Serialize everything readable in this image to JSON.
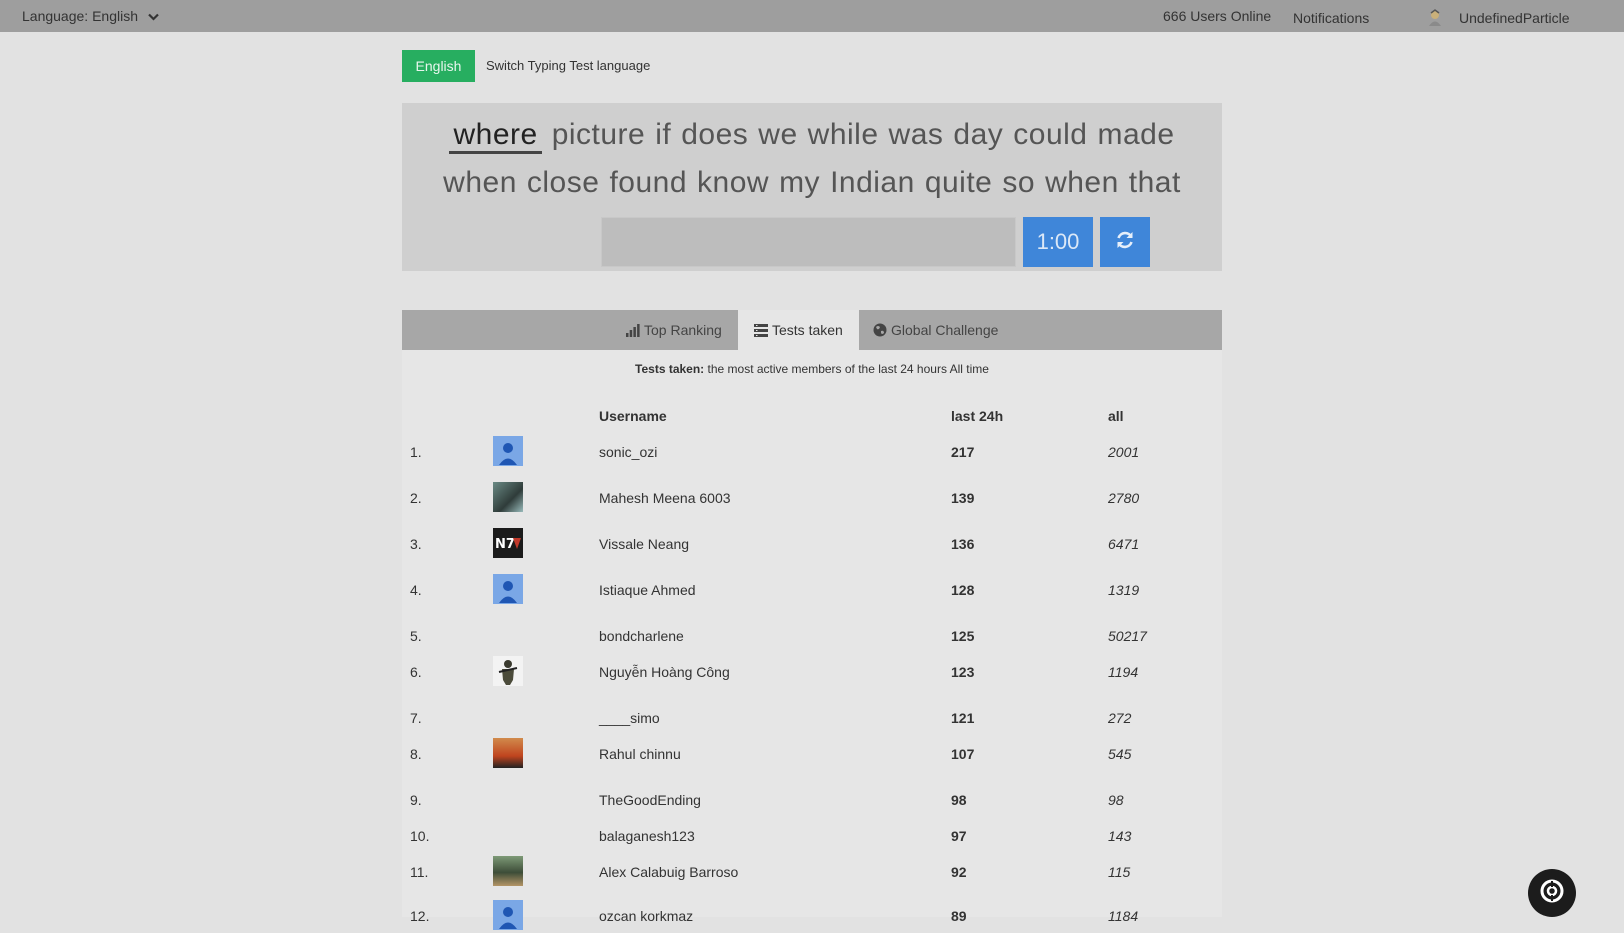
{
  "topbar": {
    "language_label": "Language: English",
    "users_online": "666 Users Online",
    "notifications": "Notifications",
    "username": "UndefinedParticle"
  },
  "language_switch": {
    "button": "English",
    "label": "Switch Typing Test language"
  },
  "typing": {
    "line1": [
      "where",
      "picture",
      "if",
      "does",
      "we",
      "while",
      "was",
      "day",
      "could",
      "made"
    ],
    "line2": [
      "when",
      "close",
      "found",
      "know",
      "my",
      "Indian",
      "quite",
      "so",
      "when",
      "that"
    ],
    "timer": "1:00"
  },
  "tabs": [
    {
      "label": "Top Ranking",
      "icon": "bar-chart-icon",
      "active": false
    },
    {
      "label": "Tests taken",
      "icon": "list-icon",
      "active": true
    },
    {
      "label": "Global Challenge",
      "icon": "globe-icon",
      "active": false
    }
  ],
  "description": {
    "bold": "Tests taken:",
    "text": " the most active members of the last 24 hours All time"
  },
  "table": {
    "headers": {
      "username": "Username",
      "last24h": "last 24h",
      "all": "all"
    },
    "rows": [
      {
        "rank": "1.",
        "username": "sonic_ozi",
        "last24h": "217",
        "all": "2001",
        "avatar": "default"
      },
      {
        "rank": "2.",
        "username": "Mahesh Meena 6003",
        "last24h": "139",
        "all": "2780",
        "avatar": "photo"
      },
      {
        "rank": "3.",
        "username": "Vissale Neang",
        "last24h": "136",
        "all": "6471",
        "avatar": "n7"
      },
      {
        "rank": "4.",
        "username": "Istiaque Ahmed",
        "last24h": "128",
        "all": "1319",
        "avatar": "default"
      },
      {
        "rank": "5.",
        "username": "bondcharlene",
        "last24h": "125",
        "all": "50217",
        "avatar": "none"
      },
      {
        "rank": "6.",
        "username": "Nguyễn Hoàng Công",
        "last24h": "123",
        "all": "1194",
        "avatar": "soldier"
      },
      {
        "rank": "7.",
        "username": "____simo",
        "last24h": "121",
        "all": "272",
        "avatar": "none"
      },
      {
        "rank": "8.",
        "username": "Rahul chinnu",
        "last24h": "107",
        "all": "545",
        "avatar": "orange"
      },
      {
        "rank": "9.",
        "username": "TheGoodEnding",
        "last24h": "98",
        "all": "98",
        "avatar": "none"
      },
      {
        "rank": "10.",
        "username": "balaganesh123",
        "last24h": "97",
        "all": "143",
        "avatar": "none"
      },
      {
        "rank": "11.",
        "username": "Alex Calabuig Barroso",
        "last24h": "92",
        "all": "115",
        "avatar": "beach"
      },
      {
        "rank": "12.",
        "username": "ozcan korkmaz",
        "last24h": "89",
        "all": "1184",
        "avatar": "default"
      }
    ]
  },
  "colors": {
    "accent_blue": "#3f86d9",
    "accent_green": "#27ae60",
    "topbar": "#9e9e9e"
  }
}
